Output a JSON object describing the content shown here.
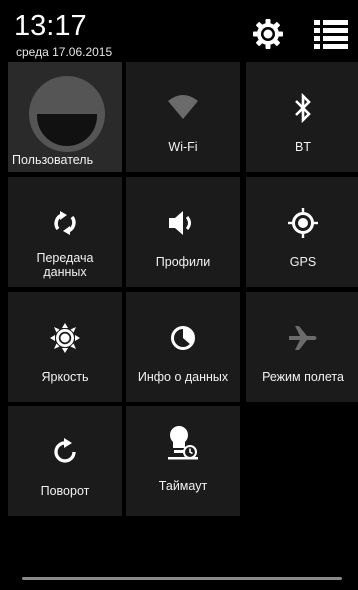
{
  "status": {
    "time": "13:17",
    "date": "среда 17.06.2015"
  },
  "header": {
    "settings_icon": "gear-icon",
    "list_icon": "list-view-icon"
  },
  "tiles": [
    {
      "id": "user",
      "label": "Пользователь",
      "icon": "user-avatar-icon"
    },
    {
      "id": "wifi",
      "label": "Wi-Fi",
      "icon": "wifi-icon",
      "state": "off"
    },
    {
      "id": "bt",
      "label": "BT",
      "icon": "bluetooth-icon"
    },
    {
      "id": "data",
      "label": "Передача данных",
      "label_lines": [
        "Передача",
        "данных"
      ],
      "icon": "sync-icon"
    },
    {
      "id": "profiles",
      "label": "Профили",
      "icon": "volume-icon"
    },
    {
      "id": "gps",
      "label": "GPS",
      "icon": "gps-icon"
    },
    {
      "id": "brightness",
      "label": "Яркость",
      "icon": "brightness-icon"
    },
    {
      "id": "datainfo",
      "label": "Инфо о данных",
      "icon": "data-usage-icon"
    },
    {
      "id": "airplane",
      "label": "Режим полета",
      "icon": "airplane-icon",
      "state": "off"
    },
    {
      "id": "rotation",
      "label": "Поворот",
      "icon": "rotate-icon"
    },
    {
      "id": "timeout",
      "label": "Таймаут",
      "icon": "screen-timeout-icon"
    }
  ],
  "colors": {
    "tile_bg": "#1b1b1b",
    "user_tile_bg": "#2a2a2a",
    "disabled_icon": "#6b6b6b",
    "icon": "#ffffff"
  }
}
